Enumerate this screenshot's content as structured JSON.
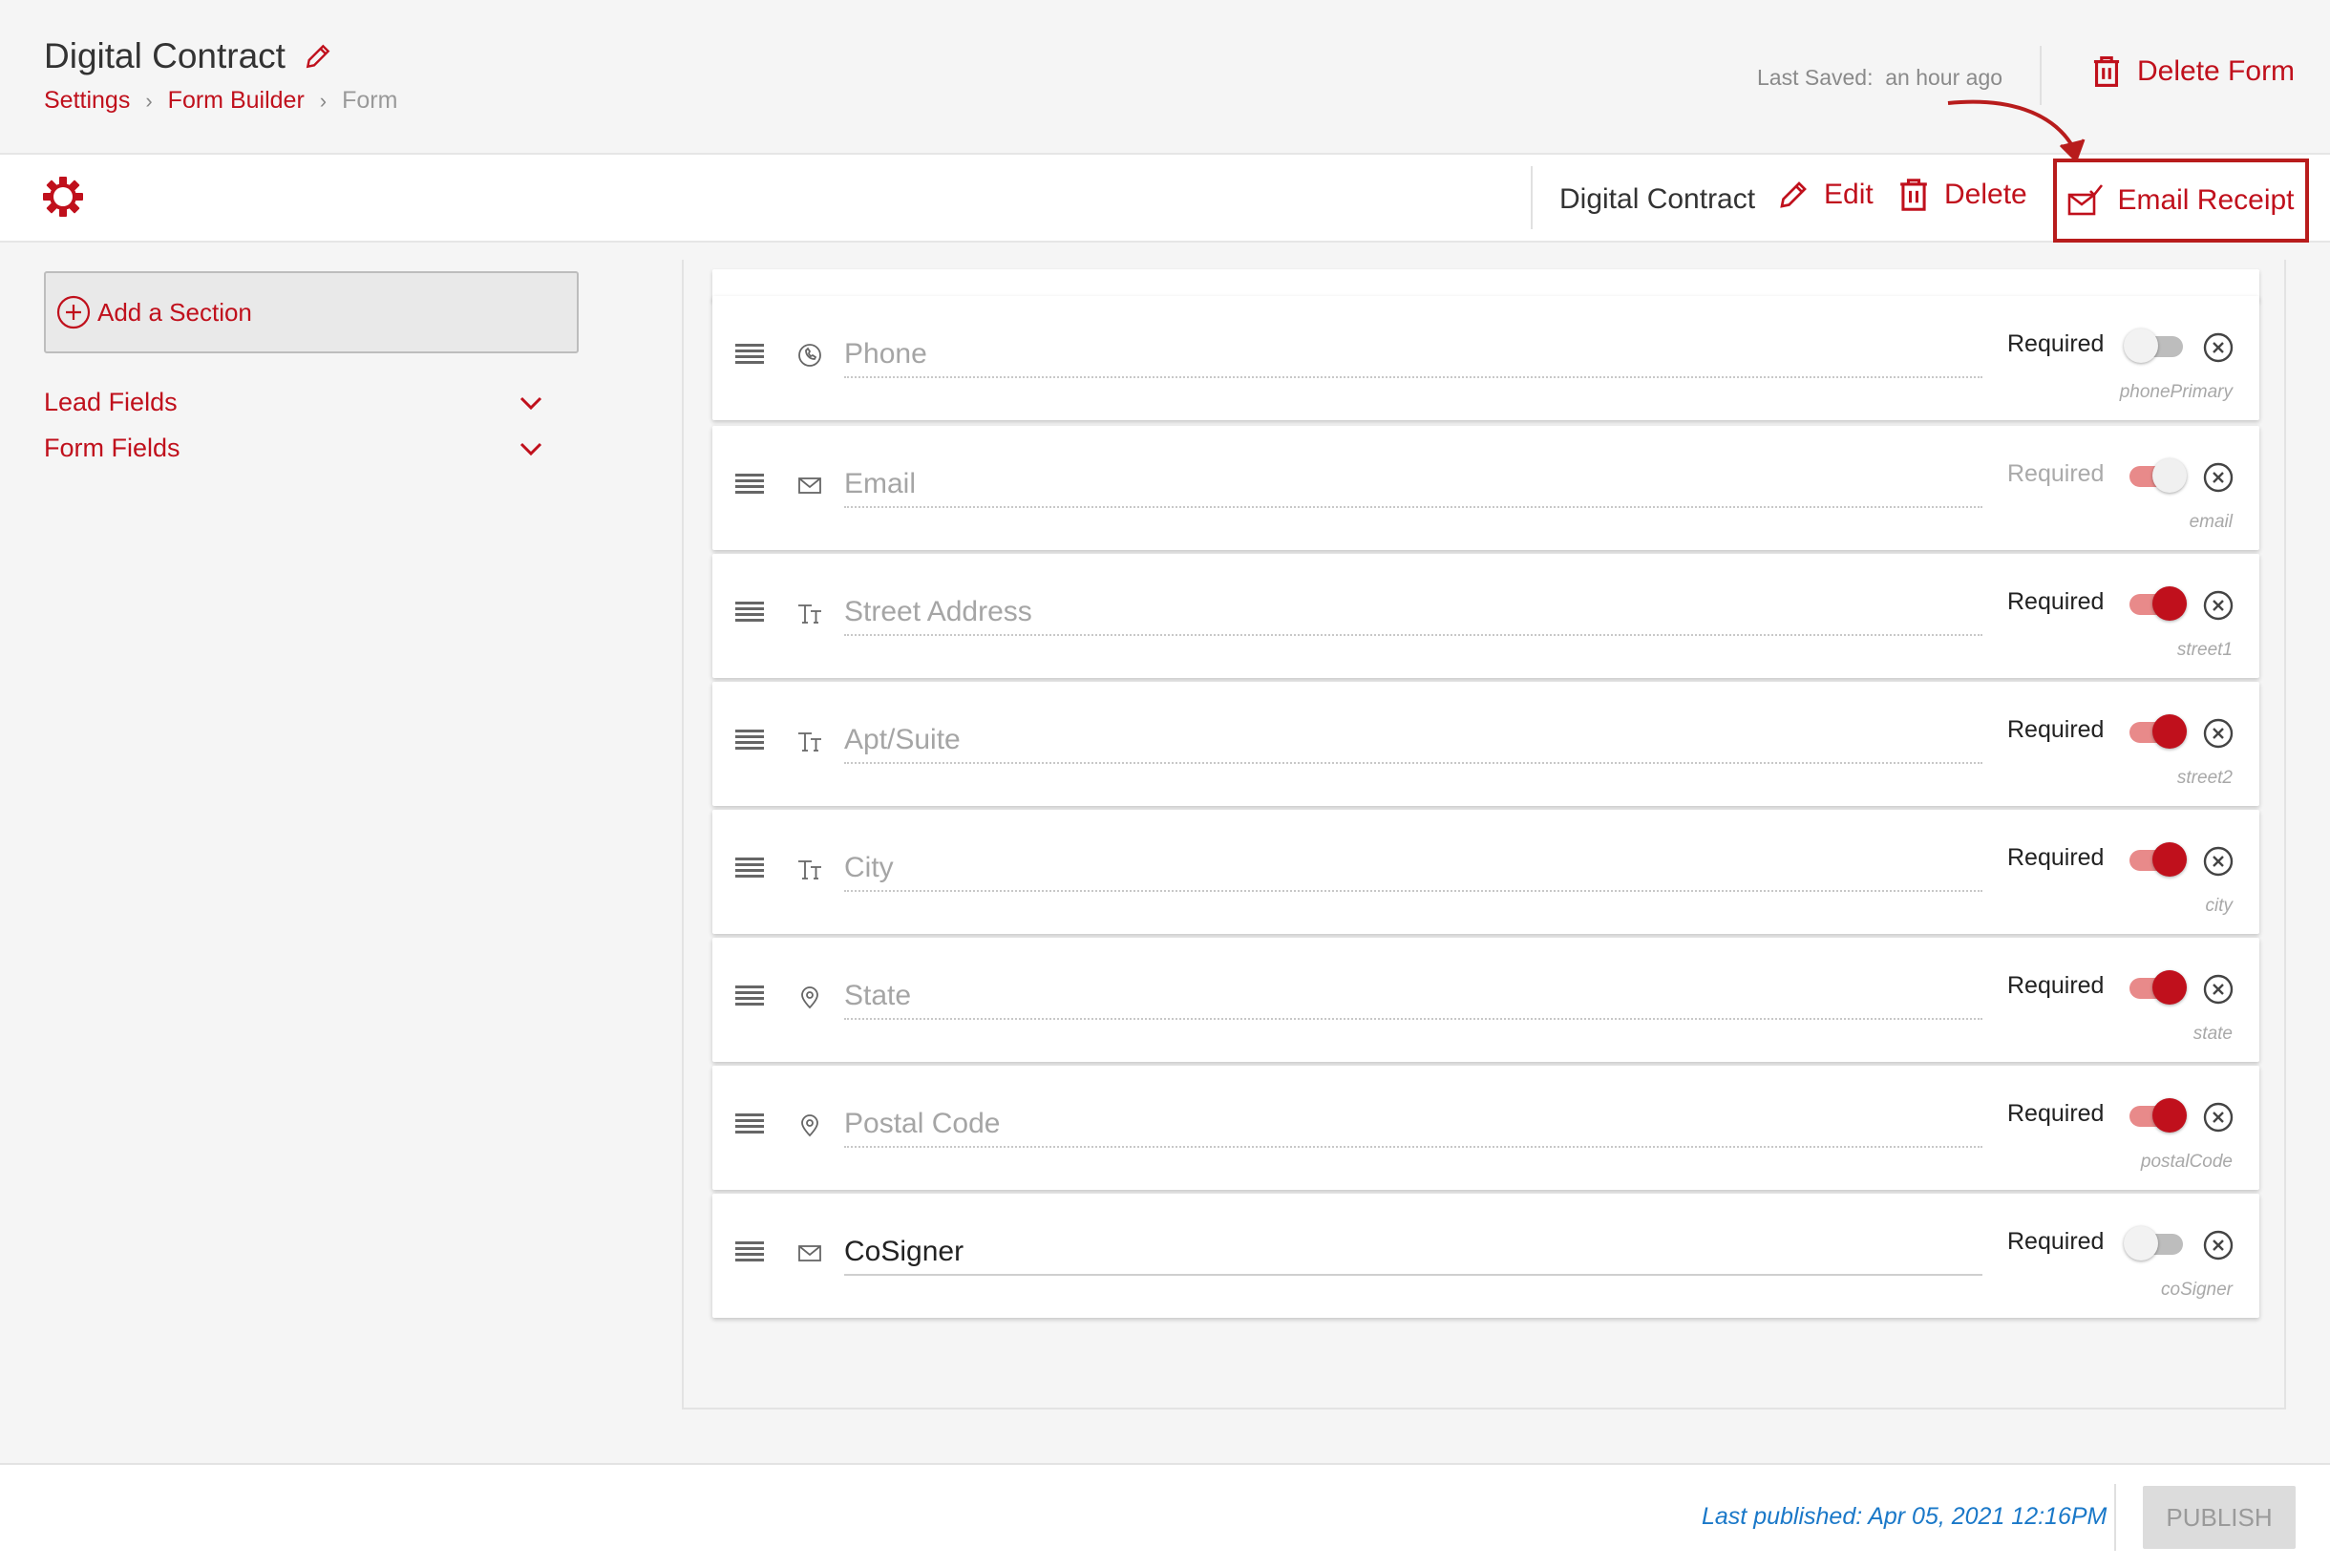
{
  "header": {
    "title": "Digital Contract",
    "breadcrumbs": [
      "Settings",
      "Form Builder",
      "Form"
    ],
    "last_saved_label": "Last Saved:",
    "last_saved_value": "an hour ago",
    "delete_form_label": "Delete Form"
  },
  "toolbar": {
    "form_name": "Digital Contract",
    "edit_label": "Edit",
    "delete_label": "Delete",
    "email_receipt_label": "Email Receipt"
  },
  "sidebar": {
    "add_section_label": "Add a Section",
    "groups": [
      "Lead Fields",
      "Form Fields"
    ]
  },
  "fields": [
    {
      "label": "Phone",
      "icon": "phone-icon",
      "required_label": "Required",
      "toggle": "off",
      "key": "phonePrimary",
      "filled": false
    },
    {
      "label": "Email",
      "icon": "mail-icon",
      "required_label": "Required",
      "toggle": "on-disabled",
      "key": "email",
      "filled": false
    },
    {
      "label": "Street Address",
      "icon": "text-size-icon",
      "required_label": "Required",
      "toggle": "on",
      "key": "street1",
      "filled": false
    },
    {
      "label": "Apt/Suite",
      "icon": "text-size-icon",
      "required_label": "Required",
      "toggle": "on",
      "key": "street2",
      "filled": false
    },
    {
      "label": "City",
      "icon": "text-size-icon",
      "required_label": "Required",
      "toggle": "on",
      "key": "city",
      "filled": false
    },
    {
      "label": "State",
      "icon": "location-pin-icon",
      "required_label": "Required",
      "toggle": "on",
      "key": "state",
      "filled": false
    },
    {
      "label": "Postal Code",
      "icon": "location-pin-icon",
      "required_label": "Required",
      "toggle": "on",
      "key": "postalCode",
      "filled": false
    },
    {
      "label": "CoSigner",
      "icon": "mail-icon",
      "required_label": "Required",
      "toggle": "off",
      "key": "coSigner",
      "filled": true
    }
  ],
  "footer": {
    "last_published": "Last published: Apr 05, 2021 12:16PM",
    "publish_label": "PUBLISH"
  },
  "colors": {
    "accent": "#c0101c",
    "toggle_track_on": "#e88a8a",
    "published_text": "#1a78c8"
  }
}
